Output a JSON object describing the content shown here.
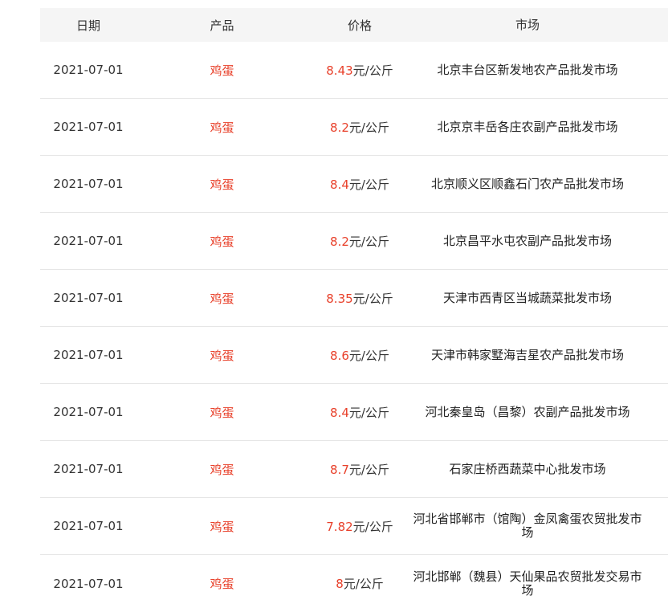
{
  "header": {
    "date": "日期",
    "product": "产品",
    "price": "价格",
    "market": "市场"
  },
  "unit": "元/公斤",
  "colors": {
    "accent": "#e8402a",
    "header_bg": "#f5f5f5",
    "divider": "#e6e6e6"
  },
  "rows": [
    {
      "date": "2021-07-01",
      "product": "鸡蛋",
      "price": "8.43",
      "market": "北京丰台区新发地农产品批发市场"
    },
    {
      "date": "2021-07-01",
      "product": "鸡蛋",
      "price": "8.2",
      "market": "北京京丰岳各庄农副产品批发市场"
    },
    {
      "date": "2021-07-01",
      "product": "鸡蛋",
      "price": "8.4",
      "market": "北京顺义区顺鑫石门农产品批发市场"
    },
    {
      "date": "2021-07-01",
      "product": "鸡蛋",
      "price": "8.2",
      "market": "北京昌平水屯农副产品批发市场"
    },
    {
      "date": "2021-07-01",
      "product": "鸡蛋",
      "price": "8.35",
      "market": "天津市西青区当城蔬菜批发市场"
    },
    {
      "date": "2021-07-01",
      "product": "鸡蛋",
      "price": "8.6",
      "market": "天津市韩家墅海吉星农产品批发市场"
    },
    {
      "date": "2021-07-01",
      "product": "鸡蛋",
      "price": "8.4",
      "market": "河北秦皇岛（昌黎）农副产品批发市场"
    },
    {
      "date": "2021-07-01",
      "product": "鸡蛋",
      "price": "8.7",
      "market": "石家庄桥西蔬菜中心批发市场"
    },
    {
      "date": "2021-07-01",
      "product": "鸡蛋",
      "price": "7.82",
      "market": "河北省邯郸市（馆陶）金凤禽蛋农贸批发市场"
    },
    {
      "date": "2021-07-01",
      "product": "鸡蛋",
      "price": "8",
      "market": "河北邯郸（魏县）天仙果品农贸批发交易市场"
    }
  ]
}
